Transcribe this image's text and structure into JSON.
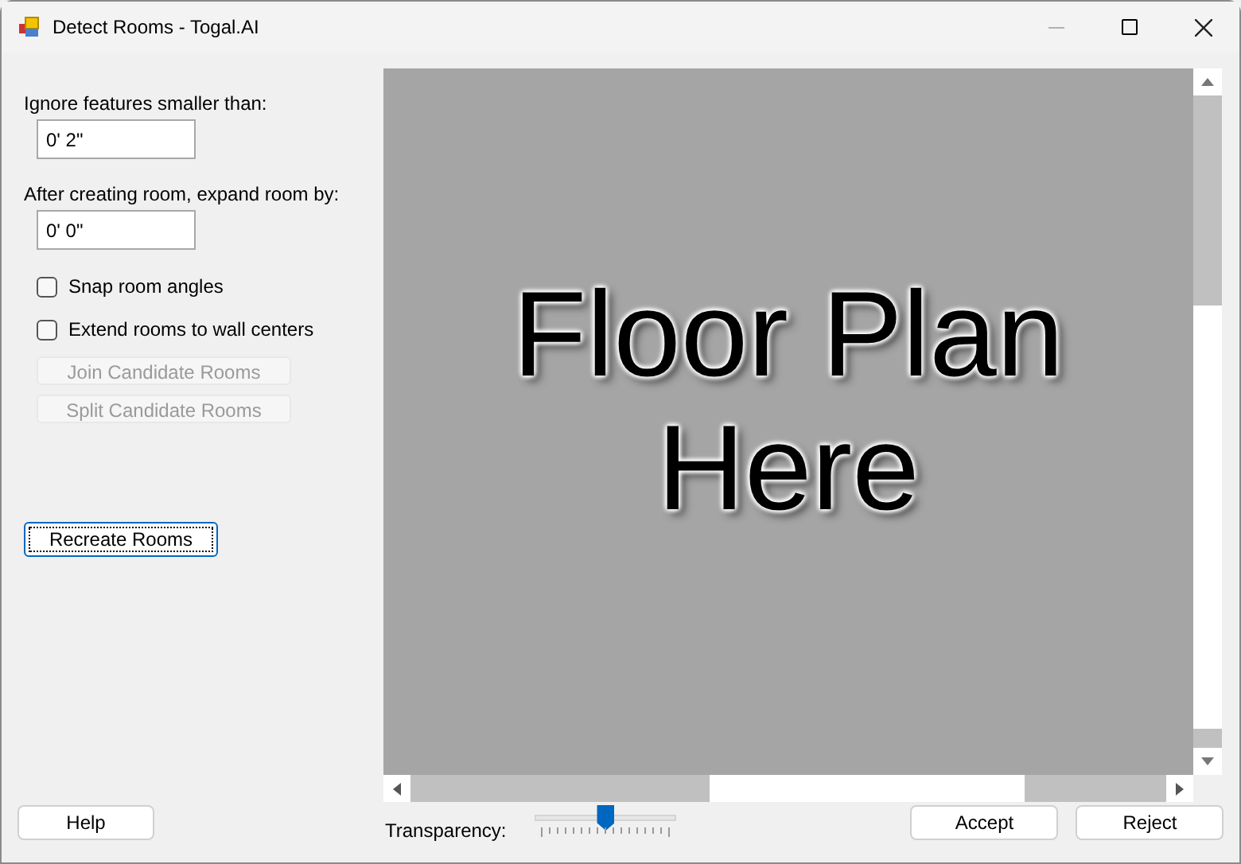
{
  "window": {
    "title": "Detect Rooms - Togal.AI"
  },
  "fields": [
    {
      "label": "Ignore features smaller than:",
      "value": "0' 2\""
    },
    {
      "label": "After creating room, expand room by:",
      "value": "0' 0\""
    }
  ],
  "checkboxes": [
    {
      "label": "Snap room angles",
      "checked": false
    },
    {
      "label": "Extend rooms to wall centers",
      "checked": false
    }
  ],
  "candidate_buttons": [
    {
      "label": "Join Candidate Rooms",
      "disabled": true
    },
    {
      "label": "Split Candidate Rooms",
      "disabled": true
    }
  ],
  "recreate_button": {
    "label": "Recreate Rooms",
    "focused": true
  },
  "canvas": {
    "placeholder_text": "Floor Plan Here"
  },
  "transparency": {
    "label": "Transparency:",
    "level": 0.5
  },
  "buttons": {
    "help": "Help",
    "accept": "Accept",
    "reject": "Reject"
  }
}
